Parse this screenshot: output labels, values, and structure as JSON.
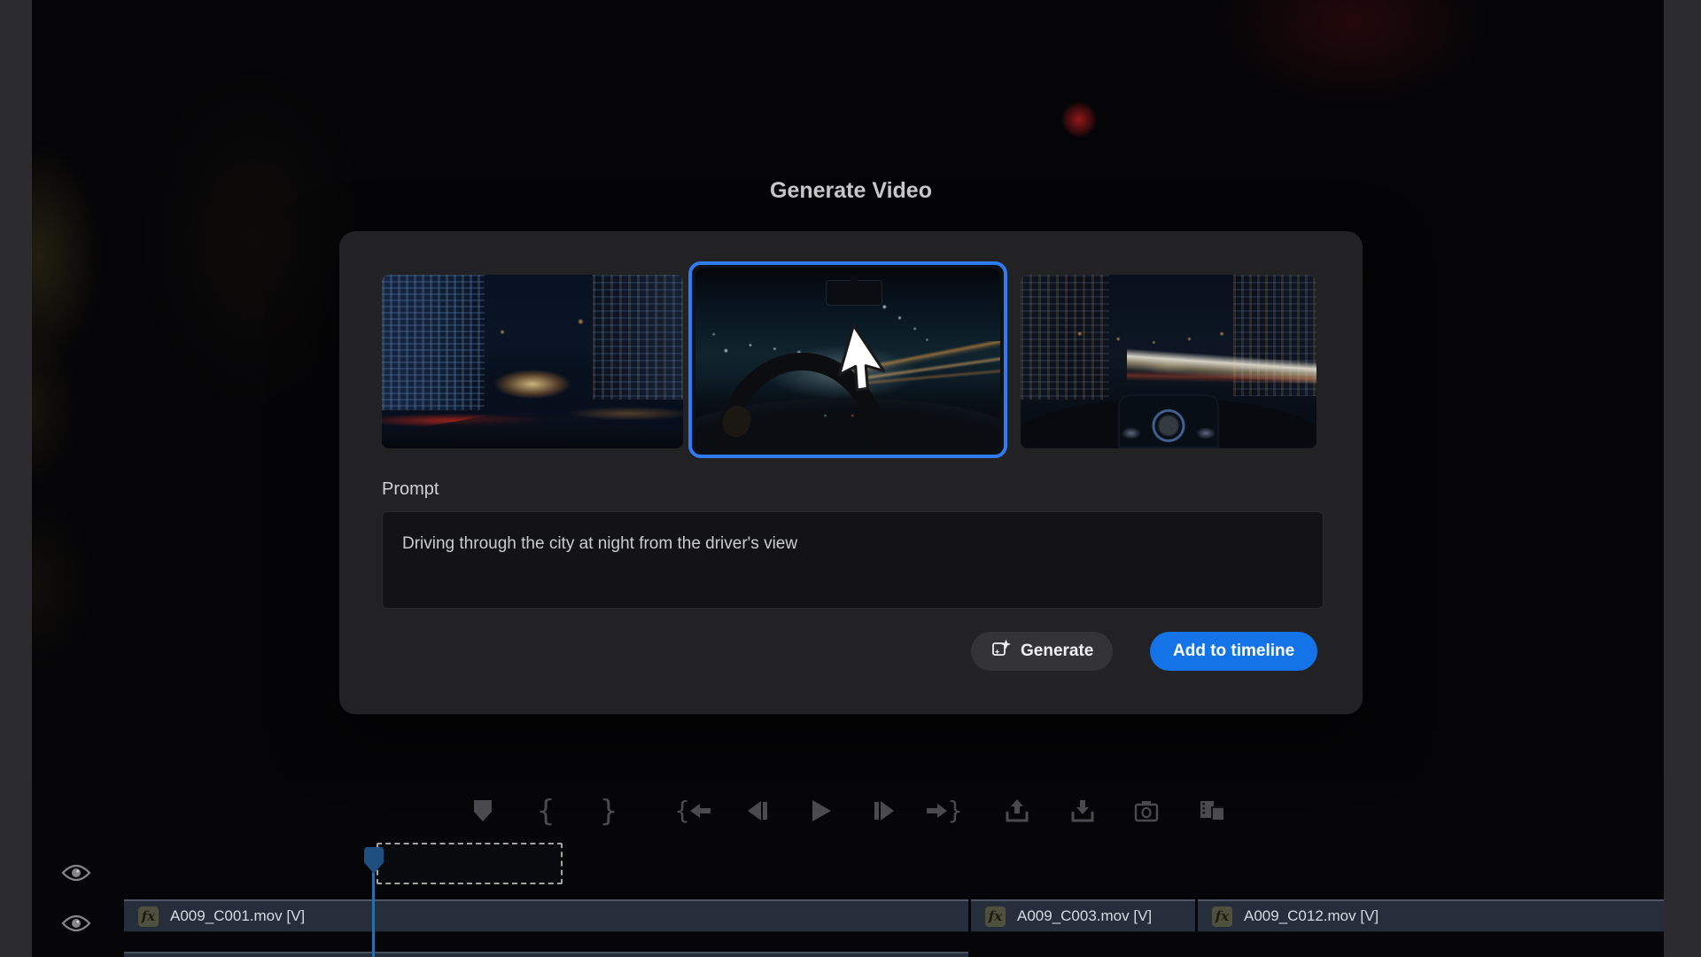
{
  "dialog": {
    "title": "Generate Video",
    "prompt_label": "Prompt",
    "prompt_value": "Driving through the city at night from the driver's view",
    "buttons": {
      "generate": "Generate",
      "add_to_timeline": "Add to timeline"
    },
    "thumbnails": [
      {
        "name": "city-street-night",
        "selected": false
      },
      {
        "name": "driver-interior-night",
        "selected": true
      },
      {
        "name": "over-wheel-city-night",
        "selected": false
      }
    ],
    "colors": {
      "accent_blue": "#1473E6",
      "selection_border": "#2F7CF2",
      "panel": "#222224"
    }
  },
  "transport": {
    "icons": [
      "add-marker",
      "mark-in",
      "mark-out",
      "go-to-in",
      "step-back",
      "play",
      "step-forward",
      "go-to-out",
      "lift",
      "extract",
      "export-frame",
      "comparison-view"
    ]
  },
  "timeline": {
    "playhead_color": "#2E6DA6",
    "tracks": [
      {
        "visibility": "on"
      },
      {
        "visibility": "on"
      }
    ],
    "clips": [
      {
        "label": "A009_C001.mov [V]",
        "badge": "fx"
      },
      {
        "label": "A009_C003.mov [V]",
        "badge": "fx"
      },
      {
        "label": "A009_C012.mov [V]",
        "badge": "fx"
      }
    ]
  }
}
